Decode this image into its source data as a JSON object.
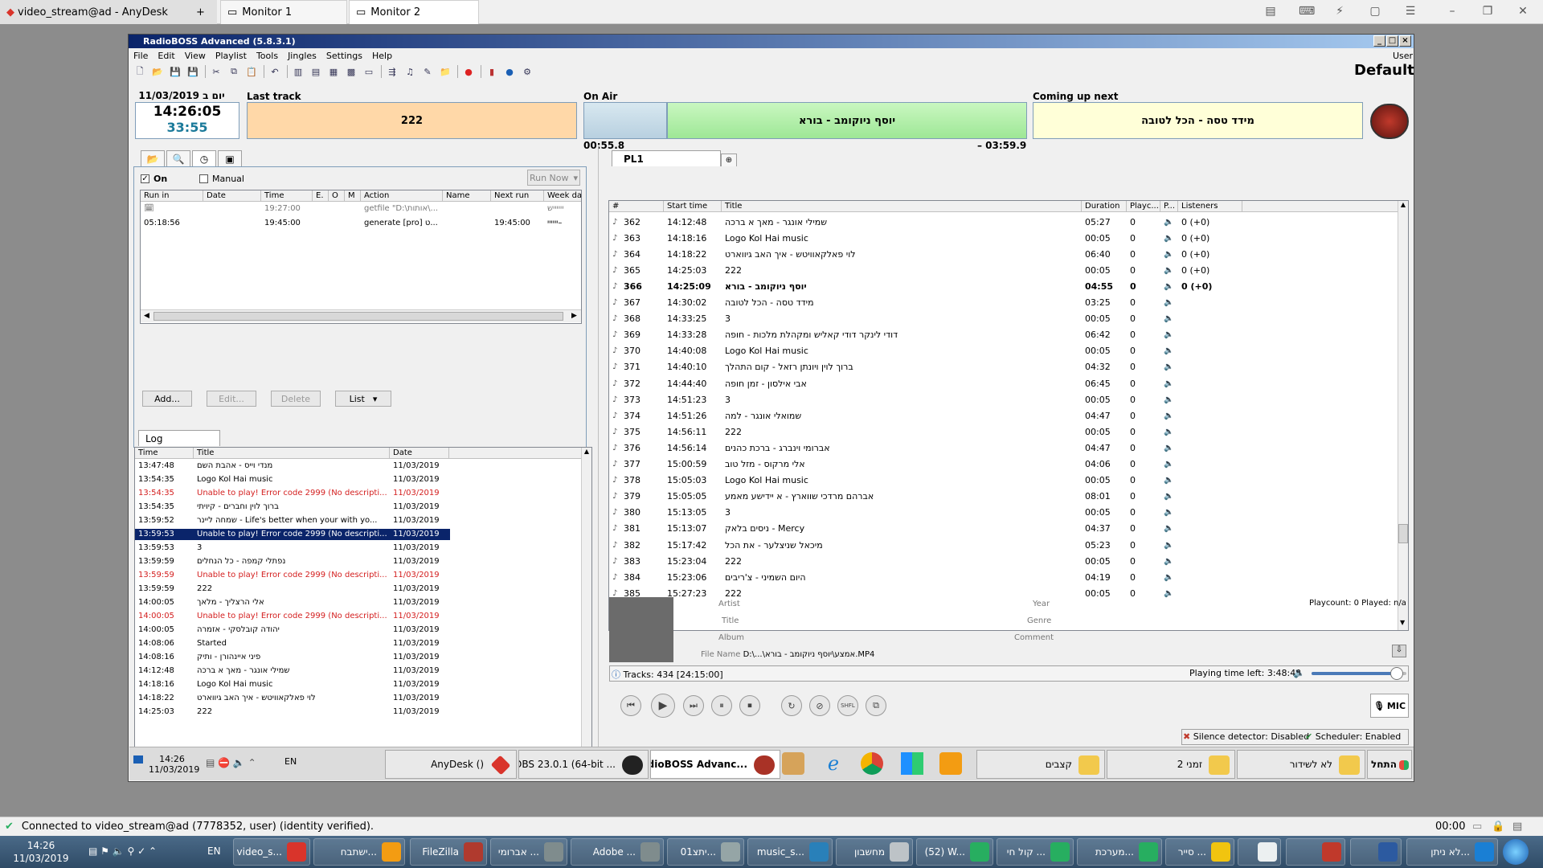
{
  "anydesk": {
    "session_tab": "video_stream@ad - AnyDesk",
    "new_tab": "+",
    "monitors": [
      "Monitor 1",
      "Monitor 2"
    ],
    "status": "Connected to video_stream@ad (7778352, user) (identity verified).",
    "timer": "00:00"
  },
  "rb": {
    "title": "RadioBOSS Advanced (5.8.3.1)",
    "menu": [
      "File",
      "Edit",
      "View",
      "Playlist",
      "Tools",
      "Jingles",
      "Settings",
      "Help"
    ],
    "user": "User",
    "profile": "Default",
    "date_day": "11/03/2019 יום ב",
    "clock": "14:26:05",
    "countdown": "33:55",
    "last_track_label": "Last track",
    "last_track": "222",
    "on_air_label": "On Air",
    "on_air": "יוסף ניוקומב - בורא",
    "elapsed": "00:55.8",
    "remaining": "– 03:59.9",
    "next_label": "Coming up next",
    "next": "מידד טסה - הכל לטובה",
    "colors": {
      "last_track_bg": "#ffd8a8",
      "on_air_bg": "#b7f0b0",
      "next_bg": "#ffffd8"
    }
  },
  "scheduler": {
    "on_label": "On",
    "manual_label": "Manual",
    "run_now": "Run Now",
    "columns": [
      "Run in",
      "Date",
      "Time",
      "E.",
      "O",
      "M",
      "Action",
      "Name",
      "Next run",
      "Week day"
    ],
    "rows": [
      {
        "run_in": "",
        "date": "",
        "time": "19:27:00",
        "e": "",
        "o": "",
        "m": "",
        "action": "getfile \"D:\\אותות\\...",
        "name": "",
        "next": "",
        "week": "ייייייש"
      },
      {
        "run_in": "05:18:56",
        "date": "",
        "time": "19:45:00",
        "e": "",
        "o": "",
        "m": "",
        "action": "generate [pro] ט...",
        "name": "",
        "next": "19:45:00",
        "week": "יייייי–"
      }
    ],
    "buttons": {
      "add": "Add...",
      "edit": "Edit...",
      "delete": "Delete",
      "list": "List"
    }
  },
  "log": {
    "tab": "Log",
    "columns": [
      "Time",
      "Title",
      "Date"
    ],
    "rows": [
      {
        "time": "13:47:48",
        "title": "מנדי וייס - אהבת השם",
        "date": "11/03/2019",
        "err": false
      },
      {
        "time": "13:54:35",
        "title": "Logo Kol Hai music",
        "date": "11/03/2019",
        "err": false
      },
      {
        "time": "13:54:35",
        "title": "Unable to play! Error code 2999 (No descripti...",
        "date": "11/03/2019",
        "err": true
      },
      {
        "time": "13:54:35",
        "title": "ברוך לוין וחברים - קיויתי",
        "date": "11/03/2019",
        "err": false
      },
      {
        "time": "13:59:52",
        "title": "שמחה ליינר - Life's better when your with yo...",
        "date": "11/03/2019",
        "err": false
      },
      {
        "time": "13:59:53",
        "title": "Unable to play! Error code 2999 (No descripti...",
        "date": "11/03/2019",
        "err": false,
        "sel": true
      },
      {
        "time": "13:59:53",
        "title": "3",
        "date": "11/03/2019",
        "err": false
      },
      {
        "time": "13:59:59",
        "title": "נפתלי קמפה - כל הנחלים",
        "date": "11/03/2019",
        "err": false
      },
      {
        "time": "13:59:59",
        "title": "Unable to play! Error code 2999 (No descripti...",
        "date": "11/03/2019",
        "err": true
      },
      {
        "time": "13:59:59",
        "title": "222",
        "date": "11/03/2019",
        "err": false
      },
      {
        "time": "14:00:05",
        "title": "אלי הרצליך - מלאך",
        "date": "11/03/2019",
        "err": false
      },
      {
        "time": "14:00:05",
        "title": "Unable to play! Error code 2999 (No descripti...",
        "date": "11/03/2019",
        "err": true
      },
      {
        "time": "14:00:05",
        "title": "יהודה קובלסקי - אזמרה",
        "date": "11/03/2019",
        "err": false
      },
      {
        "time": "14:08:06",
        "title": "Started",
        "date": "11/03/2019",
        "err": false
      },
      {
        "time": "14:08:16",
        "title": "פיני איינהורן - ותיק",
        "date": "11/03/2019",
        "err": false
      },
      {
        "time": "14:12:48",
        "title": "שמילי אונגר - מאך א ברכה",
        "date": "11/03/2019",
        "err": false
      },
      {
        "time": "14:18:16",
        "title": "Logo Kol Hai music",
        "date": "11/03/2019",
        "err": false
      },
      {
        "time": "14:18:22",
        "title": "לוי פאלקאוויטש - איך האב גיווארט",
        "date": "11/03/2019",
        "err": false
      },
      {
        "time": "14:25:03",
        "title": "222",
        "date": "11/03/2019",
        "err": false
      }
    ]
  },
  "playlist": {
    "tab": "PL1",
    "columns": [
      "#",
      "Start time",
      "Title",
      "Duration",
      "Playc...",
      "P...",
      "Listeners"
    ],
    "rows": [
      {
        "n": "362",
        "start": "14:12:48",
        "title": "שמילי אונגר - מאך א ברכה",
        "dur": "05:27",
        "pc": "0",
        "lis": "0 (+0)"
      },
      {
        "n": "363",
        "start": "14:18:16",
        "title": "Logo Kol Hai music",
        "dur": "00:05",
        "pc": "0",
        "lis": "0 (+0)"
      },
      {
        "n": "364",
        "start": "14:18:22",
        "title": "לוי פאלקאוויטש - איך האב גיווארט",
        "dur": "06:40",
        "pc": "0",
        "lis": "0 (+0)"
      },
      {
        "n": "365",
        "start": "14:25:03",
        "title": "222",
        "dur": "00:05",
        "pc": "0",
        "lis": "0 (+0)"
      },
      {
        "n": "366",
        "start": "14:25:09",
        "title": "יוסף ניוקומב - בורא",
        "dur": "04:55",
        "pc": "0",
        "lis": "0 (+0)",
        "bold": true
      },
      {
        "n": "367",
        "start": "14:30:02",
        "title": "מידד טסה - הכל לטובה",
        "dur": "03:25",
        "pc": "0",
        "lis": ""
      },
      {
        "n": "368",
        "start": "14:33:25",
        "title": "3",
        "dur": "00:05",
        "pc": "0",
        "lis": ""
      },
      {
        "n": "369",
        "start": "14:33:28",
        "title": "דודי לינקר דודי קאליש ומקהלת מלכות - חופה",
        "dur": "06:42",
        "pc": "0",
        "lis": ""
      },
      {
        "n": "370",
        "start": "14:40:08",
        "title": "Logo Kol Hai music",
        "dur": "00:05",
        "pc": "0",
        "lis": ""
      },
      {
        "n": "371",
        "start": "14:40:10",
        "title": "ברוך לוין ויונתן רזאל - קום התהלך",
        "dur": "04:32",
        "pc": "0",
        "lis": ""
      },
      {
        "n": "372",
        "start": "14:44:40",
        "title": "אבי אילסון - זמן חופה",
        "dur": "06:45",
        "pc": "0",
        "lis": ""
      },
      {
        "n": "373",
        "start": "14:51:23",
        "title": "3",
        "dur": "00:05",
        "pc": "0",
        "lis": ""
      },
      {
        "n": "374",
        "start": "14:51:26",
        "title": "שמואלי אונגר - למה",
        "dur": "04:47",
        "pc": "0",
        "lis": ""
      },
      {
        "n": "375",
        "start": "14:56:11",
        "title": "222",
        "dur": "00:05",
        "pc": "0",
        "lis": ""
      },
      {
        "n": "376",
        "start": "14:56:14",
        "title": "אברומי וינברג - ברכת כהנים",
        "dur": "04:47",
        "pc": "0",
        "lis": ""
      },
      {
        "n": "377",
        "start": "15:00:59",
        "title": "אלי מרקוס - מזל טוב",
        "dur": "04:06",
        "pc": "0",
        "lis": ""
      },
      {
        "n": "378",
        "start": "15:05:03",
        "title": "Logo Kol Hai music",
        "dur": "00:05",
        "pc": "0",
        "lis": ""
      },
      {
        "n": "379",
        "start": "15:05:05",
        "title": "אברהם מרדכי שווארץ - א יידישע מאמע",
        "dur": "08:01",
        "pc": "0",
        "lis": ""
      },
      {
        "n": "380",
        "start": "15:13:05",
        "title": "3",
        "dur": "00:05",
        "pc": "0",
        "lis": ""
      },
      {
        "n": "381",
        "start": "15:13:07",
        "title": "ניסים בלאק - Mercy",
        "dur": "04:37",
        "pc": "0",
        "lis": ""
      },
      {
        "n": "382",
        "start": "15:17:42",
        "title": "מיכאל שניצלער - את הכל",
        "dur": "05:23",
        "pc": "0",
        "lis": ""
      },
      {
        "n": "383",
        "start": "15:23:04",
        "title": "222",
        "dur": "00:05",
        "pc": "0",
        "lis": ""
      },
      {
        "n": "384",
        "start": "15:23:06",
        "title": "היום השמיני - צ'ריבים",
        "dur": "04:19",
        "pc": "0",
        "lis": ""
      },
      {
        "n": "385",
        "start": "15:27:23",
        "title": "222",
        "dur": "00:05",
        "pc": "0",
        "lis": ""
      }
    ],
    "info": {
      "artist": "Artist",
      "title": "Title",
      "album": "Album",
      "year": "Year",
      "genre": "Genre",
      "comment": "Comment",
      "file_name_label": "File Name",
      "file_name": "D:\\...\\אמצע\\יוסף ניוקומב - בורא.MP4",
      "playcount": "Playcount: 0  Played: n/a"
    },
    "tracks": "Tracks: 434 [24:15:00]",
    "time_left": "Playing time left: 3:48:42",
    "volume": 0.9,
    "mic": "MIC",
    "shfl": "SHFL",
    "silence": "Silence detector: Disabled",
    "scheduler_status": "Scheduler: Enabled"
  },
  "remote_taskbar": {
    "time": "14:26",
    "date": "11/03/2019",
    "lang": "EN",
    "buttons": [
      "AnyDesk ()",
      "OBS 23.0.1 (64-bit ...",
      "RadioBOSS Advanc...",
      "קצבים",
      "זמני 2",
      "לא לשידור",
      "התחל"
    ]
  },
  "win_taskbar": {
    "time": "14:26",
    "date": "11/03/2019",
    "lang": "EN",
    "buttons": [
      "video_s...",
      "ישתבח...",
      "FileZilla",
      "אברומי ...",
      "Adobe ...",
      "יתצ01...",
      "music_s...",
      "מחשבון",
      "(52) W...",
      "קול חי ...",
      "מערכת...",
      "סייר ...",
      "",
      "",
      "",
      "לא ניתן..."
    ]
  }
}
